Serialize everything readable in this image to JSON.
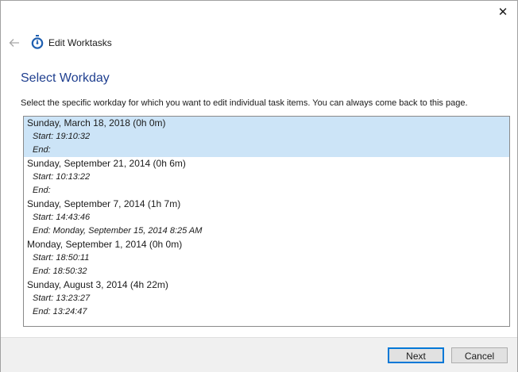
{
  "window": {
    "close_glyph": "✕"
  },
  "header": {
    "app_title": "Edit Worktasks",
    "back_icon": "arrow-left-icon",
    "app_icon": "stopwatch-icon",
    "accent_color": "#1f3f8f"
  },
  "page": {
    "main_instruction": "Select Workday",
    "content": "Select the specific workday for which you want to edit individual task items. You can always come back to this page."
  },
  "workdays": [
    {
      "title": "Sunday, March 18, 2018 (0h 0m)",
      "start": "Start: 19:10:32",
      "end": "End:",
      "selected": true
    },
    {
      "title": "Sunday, September 21, 2014 (0h 6m)",
      "start": "Start: 10:13:22",
      "end": "End:",
      "selected": false
    },
    {
      "title": "Sunday, September 7, 2014 (1h 7m)",
      "start": "Start: 14:43:46",
      "end": "End: Monday, September 15, 2014 8:25 AM",
      "selected": false
    },
    {
      "title": "Monday, September 1, 2014 (0h 0m)",
      "start": "Start: 18:50:11",
      "end": "End: 18:50:32",
      "selected": false
    },
    {
      "title": "Sunday, August 3, 2014 (4h 22m)",
      "start": "Start: 13:23:27",
      "end": "End: 13:24:47",
      "selected": false
    }
  ],
  "footer": {
    "next_label": "Next",
    "cancel_label": "Cancel"
  }
}
